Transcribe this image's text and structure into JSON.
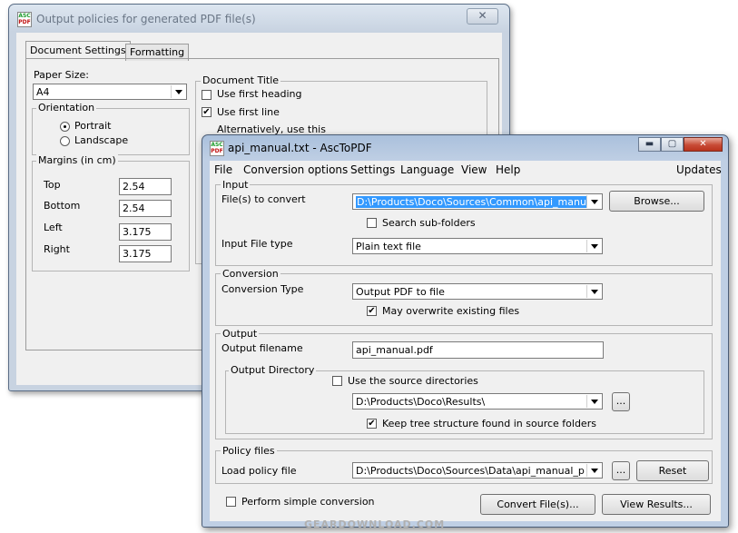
{
  "back_window": {
    "title": "Output policies for generated PDF file(s)",
    "close_glyph": "✕",
    "tabs": [
      "Document Settings",
      "Formatting"
    ],
    "paper_size_label": "Paper Size:",
    "paper_size_value": "A4",
    "orientation_label": "Orientation",
    "orientation_portrait": "Portrait",
    "orientation_landscape": "Landscape",
    "margins_label": "Margins (in cm)",
    "margins": [
      {
        "label": "Top",
        "value": "2.54"
      },
      {
        "label": "Bottom",
        "value": "2.54"
      },
      {
        "label": "Left",
        "value": "3.175"
      },
      {
        "label": "Right",
        "value": "3.175"
      }
    ],
    "doc_title_label": "Document Title",
    "use_first_heading": "Use first heading",
    "use_first_line": "Use first line",
    "alternatively": "Alternatively, use this"
  },
  "front_window": {
    "title": "api_manual.txt - AscToPDF",
    "controls": {
      "minimize": "▬",
      "maximize": "▢",
      "close": "✕"
    },
    "menu": [
      "File",
      "Conversion options",
      "Settings",
      "Language",
      "View",
      "Help"
    ],
    "menu_right": "Updates",
    "input": {
      "group_label": "Input",
      "files_label": "File(s) to convert",
      "files_value": "D:\\Products\\Doco\\Sources\\Common\\api_manual.txt",
      "browse_label": "Browse...",
      "search_subfolders": "Search sub-folders",
      "file_type_label": "Input File type",
      "file_type_value": "Plain text file"
    },
    "conversion": {
      "group_label": "Conversion",
      "type_label": "Conversion Type",
      "type_value": "Output PDF to file",
      "overwrite": "May overwrite existing files"
    },
    "output": {
      "group_label": "Output",
      "filename_label": "Output filename",
      "filename_value": "api_manual.pdf",
      "dir_group_label": "Output Directory",
      "use_source_dirs": "Use the source directories",
      "dir_value": "D:\\Products\\Doco\\Results\\",
      "dir_browse": "...",
      "keep_tree": "Keep tree structure found in source folders"
    },
    "policy": {
      "group_label": "Policy files",
      "load_label": "Load policy file",
      "load_value": "D:\\Products\\Doco\\Sources\\Data\\api_manual_pdf.pc",
      "browse": "...",
      "reset": "Reset"
    },
    "simple_conversion": "Perform simple conversion",
    "convert_button": "Convert File(s)...",
    "view_results_button": "View Results..."
  },
  "checkmark": "✔",
  "watermark": "GEARDOWNLOAD.COM"
}
